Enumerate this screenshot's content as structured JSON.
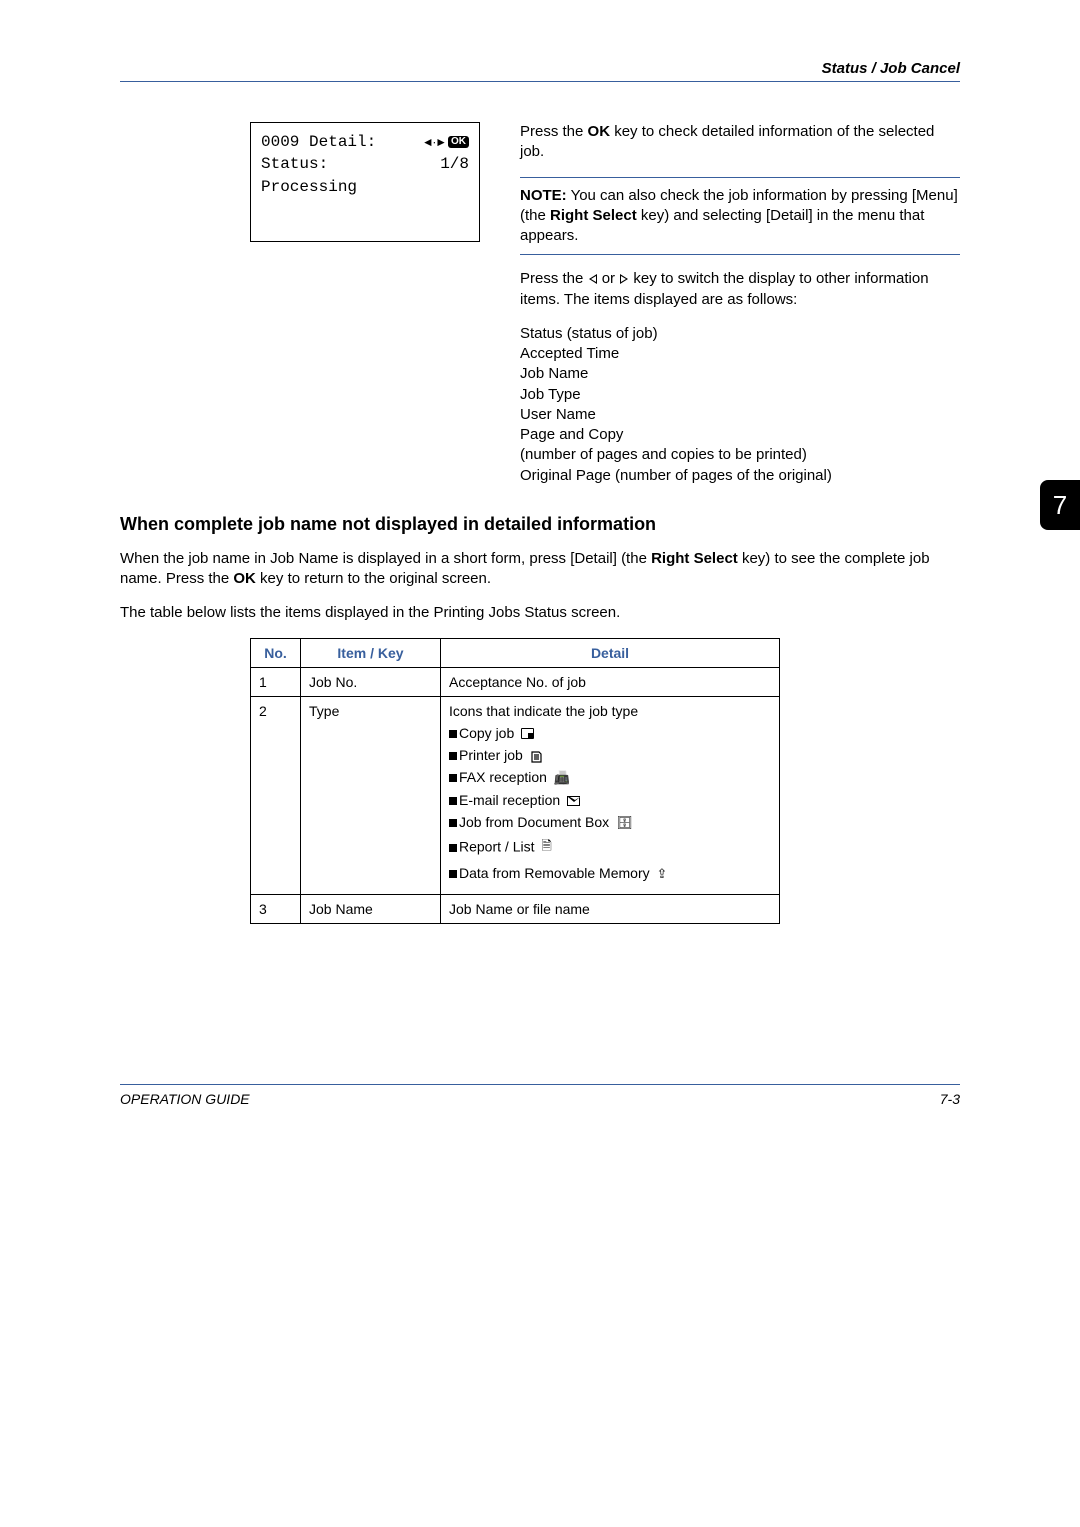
{
  "header": {
    "section_title": "Status / Job Cancel"
  },
  "chapter_tab": "7",
  "lcd": {
    "title": "0009 Detail:",
    "page_indicator": "1/8",
    "status_label": "Status:",
    "status_value": "Processing"
  },
  "rightcol": {
    "p1_a": "Press the ",
    "p1_b": "OK",
    "p1_c": " key to check detailed information of the selected job.",
    "note_a": "NOTE:",
    "note_b": " You can also check the job information by pressing [Menu] (the ",
    "note_c": "Right Select",
    "note_d": " key) and selecting [Detail] in the menu that appears.",
    "p2_a": "Press the ",
    "p2_b": " or ",
    "p2_c": " key to switch the display to other information items. The items displayed are as follows:",
    "items_list": [
      "Status (status of job)",
      "Accepted Time",
      "Job Name",
      "Job Type",
      "User Name",
      "Page and Copy",
      "(number of pages and copies to be printed)",
      "Original Page (number of pages of the original)"
    ]
  },
  "subhead": "When complete job name not displayed in detailed information",
  "body_p1_a": "When the job name in Job Name is displayed in a short form, press [Detail] (the ",
  "body_p1_b": "Right Select",
  "body_p1_c": " key) to see the complete job name. Press the ",
  "body_p1_d": "OK",
  "body_p1_e": " key to return to the original screen.",
  "body_p2": "The table below lists the items displayed in the Printing Jobs Status screen.",
  "table": {
    "head_no": "No.",
    "head_item": "Item / Key",
    "head_detail": "Detail",
    "rows": [
      {
        "no": "1",
        "item": "Job No.",
        "detail": "Acceptance No. of job"
      },
      {
        "no": "2",
        "item": "Type",
        "detail_intro": "Icons that indicate the job type",
        "types": [
          {
            "label": "Copy job"
          },
          {
            "label": "Printer job"
          },
          {
            "label": "FAX reception"
          },
          {
            "label": "E-mail reception"
          },
          {
            "label": "Job from Document Box"
          },
          {
            "label": "Report / List"
          },
          {
            "label": "Data from Removable Memory"
          }
        ]
      },
      {
        "no": "3",
        "item": "Job Name",
        "detail": "Job Name or file name"
      }
    ]
  },
  "footer": {
    "left": "OPERATION GUIDE",
    "right": "7-3"
  }
}
